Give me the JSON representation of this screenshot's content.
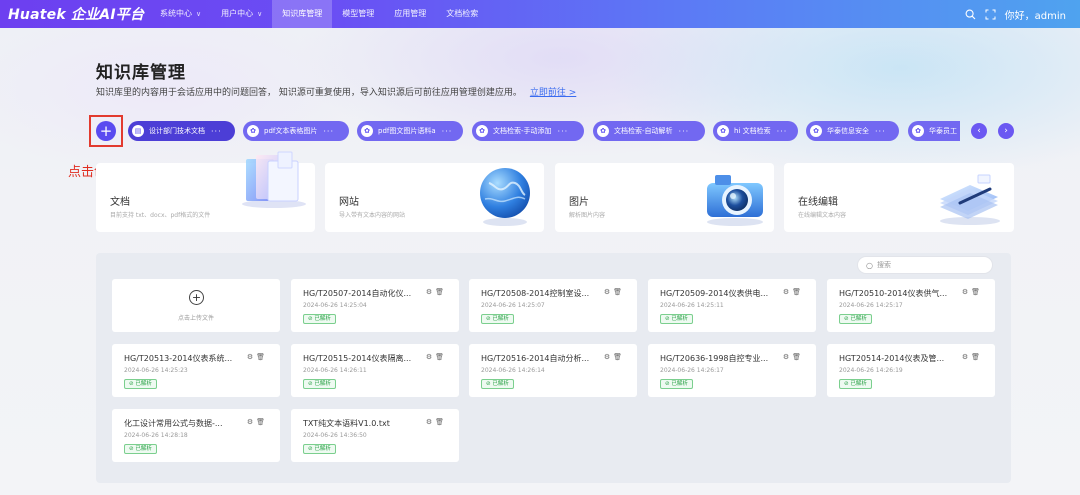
{
  "header": {
    "logo": "Huatek 企业AI平台",
    "nav": [
      {
        "label": "系统中心",
        "chevron": true,
        "active": false
      },
      {
        "label": "用户中心",
        "chevron": true,
        "active": false
      },
      {
        "label": "知识库管理",
        "chevron": false,
        "active": true
      },
      {
        "label": "模型管理",
        "chevron": false,
        "active": false
      },
      {
        "label": "应用管理",
        "chevron": false,
        "active": false
      },
      {
        "label": "文档检索",
        "chevron": false,
        "active": false
      }
    ],
    "greeting": "你好，admin"
  },
  "page": {
    "title": "知识库管理",
    "description": "知识库里的内容用于会话应用中的问题回答， 知识源可重复使用，导入知识源后可前往应用管理创建应用。",
    "link": "立即前往 >",
    "annotation": "点击创建知识库"
  },
  "knowledge_bases": [
    {
      "label": "设计部门技术文档"
    },
    {
      "label": "pdf文本表格图片"
    },
    {
      "label": "pdf图文图片语料a"
    },
    {
      "label": "文档检索-手动添加"
    },
    {
      "label": "文档检索-自动解析"
    },
    {
      "label": "hi 文档检索"
    },
    {
      "label": "华泰信息安全"
    },
    {
      "label": "华泰员工"
    }
  ],
  "source_types": [
    {
      "name": "文档",
      "sub": "目前支持 txt、docx、pdf格式的文件"
    },
    {
      "name": "网站",
      "sub": "导入带有文本内容的网站"
    },
    {
      "name": "图片",
      "sub": "解析图片内容"
    },
    {
      "name": "在线编辑",
      "sub": "在线编辑文本内容"
    }
  ],
  "search": {
    "placeholder": "搜索"
  },
  "upload": {
    "label": "点击上传文件"
  },
  "status_label": "已解析",
  "files": [
    {
      "name": "HG/T20507-2014自动化仪...",
      "time": "2024-06-26 14:25:04"
    },
    {
      "name": "HG/T20508-2014控制室设...",
      "time": "2024-06-26 14:25:07"
    },
    {
      "name": "HG/T20509-2014仪表供电...",
      "time": "2024-06-26 14:25:11"
    },
    {
      "name": "HG/T20510-2014仪表供气...",
      "time": "2024-06-26 14:25:17"
    },
    {
      "name": "HG/T20513-2014仪表系统...",
      "time": "2024-06-26 14:25:23"
    },
    {
      "name": "HG/T20515-2014仪表隔离...",
      "time": "2024-06-26 14:26:11"
    },
    {
      "name": "HG/T20516-2014自动分析...",
      "time": "2024-06-26 14:26:14"
    },
    {
      "name": "HG/T20636-1998自控专业...",
      "time": "2024-06-26 14:26:17"
    },
    {
      "name": "HGT20514-2014仪表及管...",
      "time": "2024-06-26 14:26:19"
    },
    {
      "name": "化工设计常用公式与数据-...",
      "time": "2024-06-26 14:28:18"
    },
    {
      "name": "TXT纯文本语料V1.0.txt",
      "time": "2024-06-26 14:36:50"
    }
  ],
  "colors": {
    "accent": "#5a4bf0",
    "annotation": "#e02d20",
    "status": "#2ea34a"
  }
}
